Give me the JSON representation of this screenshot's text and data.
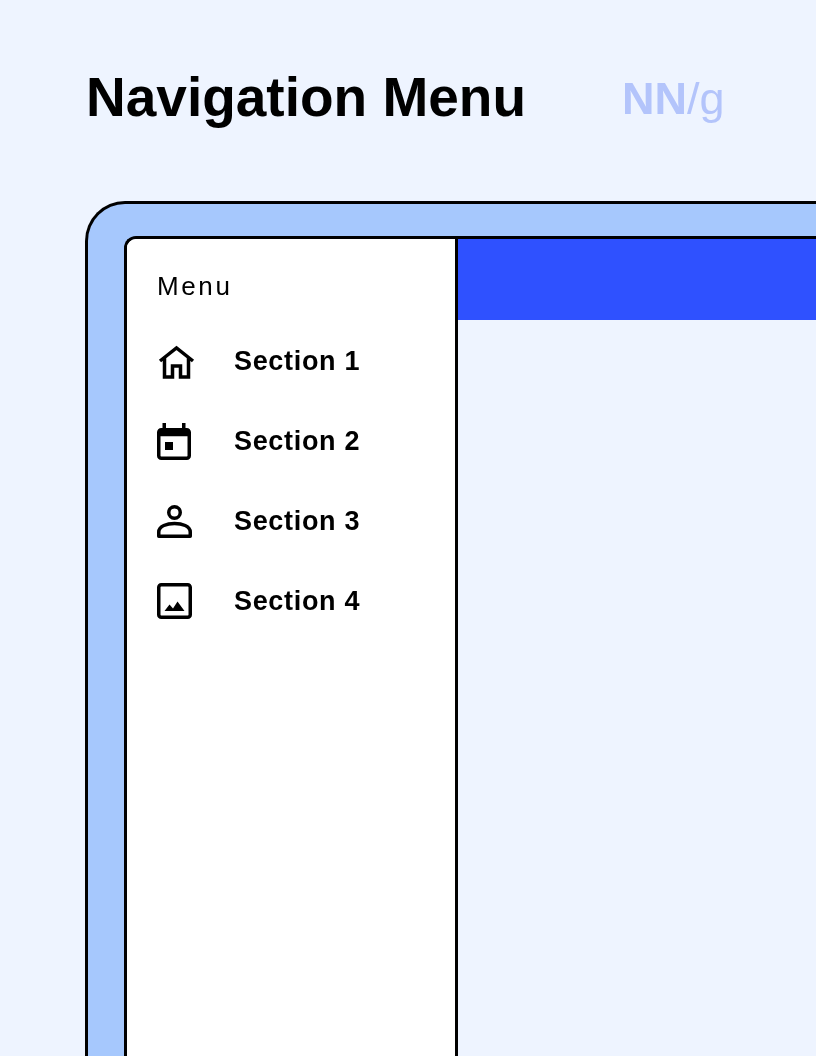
{
  "header": {
    "title": "Navigation Menu",
    "logo": "**NN**/g"
  },
  "sidebar": {
    "heading": "Menu",
    "items": [
      {
        "label": "Section 1"
      },
      {
        "label": "Section 2"
      },
      {
        "label": "Section 3"
      },
      {
        "label": "Section 4"
      }
    ]
  }
}
